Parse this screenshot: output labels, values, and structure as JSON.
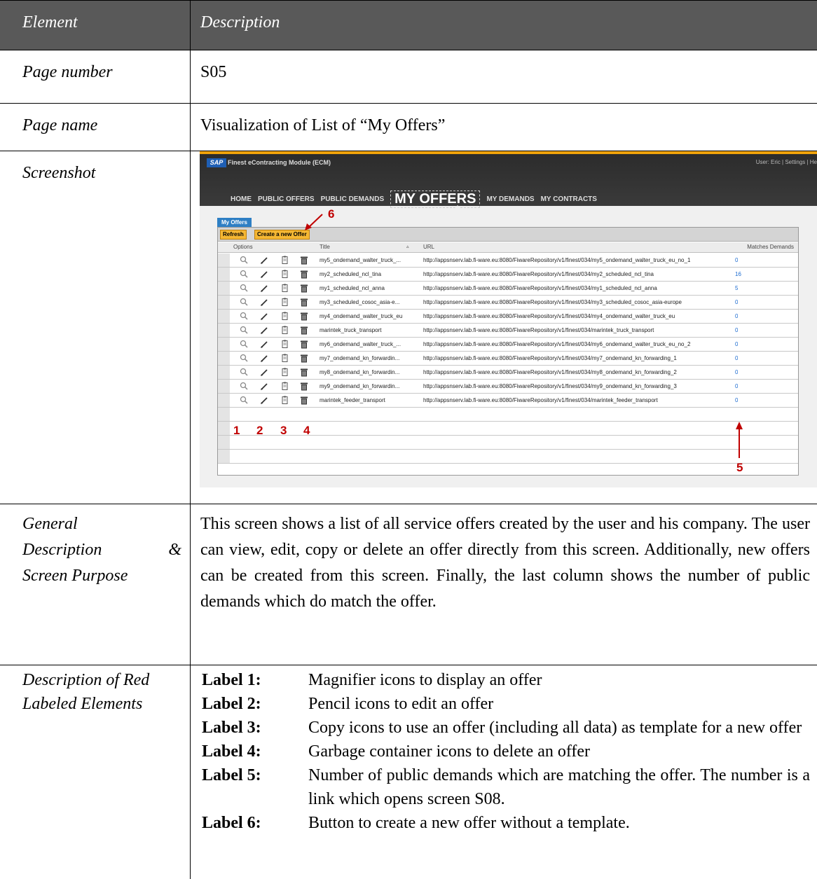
{
  "header": {
    "element": "Element",
    "description": "Description"
  },
  "page_number": {
    "label": "Page number",
    "value": "S05"
  },
  "page_name": {
    "label": "Page name",
    "value": "Visualization of List of “My Offers”"
  },
  "screenshot": {
    "label": "Screenshot",
    "app": {
      "logo": "SAP",
      "title": "Finest eContracting Module (ECM)",
      "user_bar": "User: Eric  |  Settings  |  He",
      "nav": [
        "HOME",
        "PUBLIC OFFERS",
        "PUBLIC DEMANDS",
        "MY OFFERS",
        "MY DEMANDS",
        "MY CONTRACTS"
      ],
      "tab": "My Offers",
      "buttons": {
        "refresh": "Refresh",
        "create": "Create a new Offer"
      },
      "columns": [
        "Options",
        "Title",
        "URL",
        "Matches Demands"
      ],
      "rows": [
        {
          "title": "my5_ondemand_walter_truck_...",
          "url": "http://appsnserv.lab.fi-ware.eu:8080/FiwareRepository/v1/finest/034/my5_ondemand_walter_truck_eu_no_1",
          "matches": "0"
        },
        {
          "title": "my2_scheduled_ncl_tina",
          "url": "http://appsnserv.lab.fi-ware.eu:8080/FiwareRepository/v1/finest/034/my2_scheduled_ncl_tina",
          "matches": "16"
        },
        {
          "title": "my1_scheduled_ncl_anna",
          "url": "http://appsnserv.lab.fi-ware.eu:8080/FiwareRepository/v1/finest/034/my1_scheduled_ncl_anna",
          "matches": "5"
        },
        {
          "title": "my3_scheduled_cosoc_asia-e...",
          "url": "http://appsnserv.lab.fi-ware.eu:8080/FiwareRepository/v1/finest/034/my3_scheduled_cosoc_asia-europe",
          "matches": "0"
        },
        {
          "title": "my4_ondemand_walter_truck_eu",
          "url": "http://appsnserv.lab.fi-ware.eu:8080/FiwareRepository/v1/finest/034/my4_ondemand_walter_truck_eu",
          "matches": "0"
        },
        {
          "title": "marintek_truck_transport",
          "url": "http://appsnserv.lab.fi-ware.eu:8080/FiwareRepository/v1/finest/034/marintek_truck_transport",
          "matches": "0"
        },
        {
          "title": "my6_ondemand_walter_truck_...",
          "url": "http://appsnserv.lab.fi-ware.eu:8080/FiwareRepository/v1/finest/034/my6_ondemand_walter_truck_eu_no_2",
          "matches": "0"
        },
        {
          "title": "my7_ondemand_kn_forwardin...",
          "url": "http://appsnserv.lab.fi-ware.eu:8080/FiwareRepository/v1/finest/034/my7_ondemand_kn_forwarding_1",
          "matches": "0"
        },
        {
          "title": "my8_ondemand_kn_forwardin...",
          "url": "http://appsnserv.lab.fi-ware.eu:8080/FiwareRepository/v1/finest/034/my8_ondemand_kn_forwarding_2",
          "matches": "0"
        },
        {
          "title": "my9_ondemand_kn_forwardin...",
          "url": "http://appsnserv.lab.fi-ware.eu:8080/FiwareRepository/v1/finest/034/my9_ondemand_kn_forwarding_3",
          "matches": "0"
        },
        {
          "title": "marintek_feeder_transport",
          "url": "http://appsnserv.lab.fi-ware.eu:8080/FiwareRepository/v1/finest/034/marintek_feeder_transport",
          "matches": "0"
        }
      ],
      "annotations": [
        "1",
        "2",
        "3",
        "4",
        "5",
        "6"
      ],
      "annotation_color": "#c00000"
    }
  },
  "general": {
    "label_lines": [
      [
        "General"
      ],
      [
        "Description",
        "&"
      ],
      [
        "Screen Purpose"
      ]
    ],
    "text": "This screen shows a list of all service offers created by the user and his company. The user can view, edit, copy or delete an offer directly from this screen. Additionally, new offers can be created from this screen. Finally, the last column shows the number of public demands which do match the offer."
  },
  "labels": {
    "label_lines": [
      "Description of Red",
      "Labeled Elements"
    ],
    "items": [
      {
        "key": "Label 1:",
        "text": "Magnifier icons to display an offer"
      },
      {
        "key": "Label 2:",
        "text": "Pencil icons to edit an offer"
      },
      {
        "key": "Label 3:",
        "text": "Copy icons to use an offer (including all data) as template for a new offer"
      },
      {
        "key": "Label 4:",
        "text": "Garbage container icons to delete an offer"
      },
      {
        "key": "Label 5:",
        "text": "Number of public demands which are matching the offer. The number is a link which opens screen S08."
      },
      {
        "key": "Label 6:",
        "text": "Button to create a new offer without a template."
      }
    ]
  },
  "colors": {
    "header_bg": "#595959",
    "app_accent": "#f0a30a",
    "tab_blue": "#2e7fc4",
    "button_orange": "#f5b733",
    "link_blue": "#1a6ad0"
  }
}
